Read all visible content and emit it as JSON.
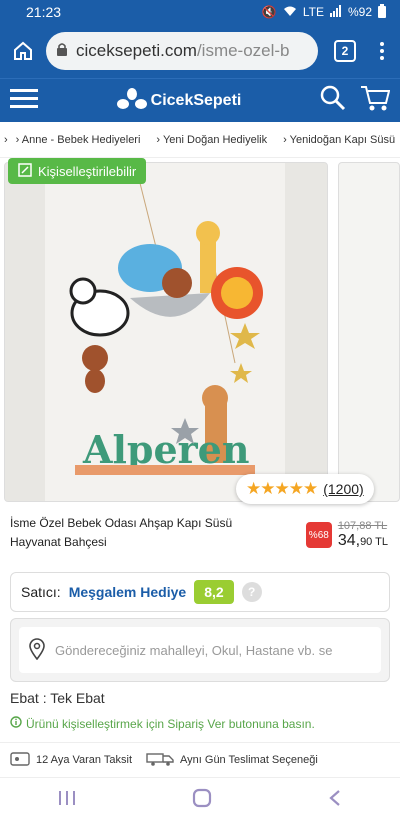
{
  "status": {
    "time": "21:23",
    "battery": "%92",
    "network": "LTE"
  },
  "browser": {
    "url_host": "ciceksepeti.com",
    "url_path": "/isme-ozel-b",
    "tab_count": "2"
  },
  "site": {
    "logo_text": "CicekSepeti"
  },
  "breadcrumb": {
    "items": [
      "Anne - Bebek Hediyeleri",
      "Yeni Doğan Hediyelik",
      "Yenidoğan Kapı Süsü"
    ]
  },
  "product": {
    "badge": "Kişiselleştirilebilir",
    "image_name_text": "Alperen",
    "rating_count": "(1200)",
    "rating_stars": 5,
    "title": "İsme Özel Bebek Odası Ahşap Kapı Süsü Hayvanat Bahçesi",
    "discount": "%68",
    "old_price": "107,88 TL",
    "price_main": "34,",
    "price_cents": "90 TL"
  },
  "seller": {
    "label": "Satıcı:",
    "name": "Meşgalem Hediye",
    "score": "8,2",
    "help": "?"
  },
  "address": {
    "placeholder": "Göndereceğiniz mahalleyi, Okul, Hastane vb. se"
  },
  "options": {
    "size": "Ebat : Tek Ebat"
  },
  "note": {
    "text": "Ürünü kişiselleştirmek için Sipariş Ver butonuna basın."
  },
  "info": {
    "installment": "12 Aya Varan Taksit",
    "delivery": "Aynı Gün Teslimat Seçeneği"
  },
  "colors": {
    "brand": "#1b5da8",
    "badge_green": "#58b947",
    "discount_red": "#e53935",
    "score_green": "#9acd32"
  }
}
